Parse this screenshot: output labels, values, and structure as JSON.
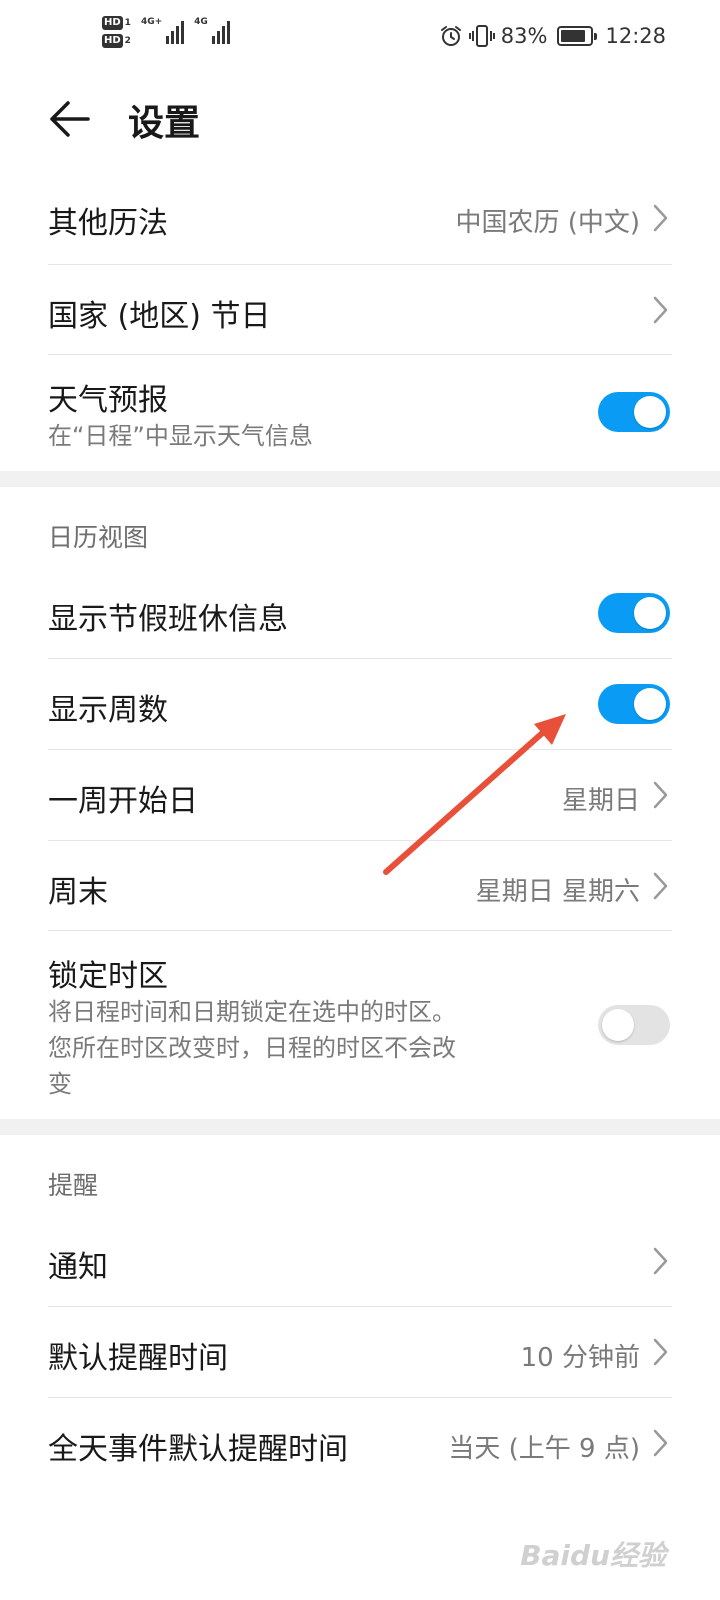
{
  "status_bar": {
    "hd1": "HD",
    "hd1_sub": "1",
    "hd2": "HD",
    "hd2_sub": "2",
    "net1": "4G+",
    "net2": "4G",
    "battery_percent": "83%",
    "battery_level": 0.83,
    "time": "12:28",
    "icons": [
      "alarm-icon",
      "vibrate-icon",
      "battery-icon"
    ]
  },
  "header": {
    "title": "设置",
    "back_icon": "arrow-left-icon"
  },
  "general": {
    "other_calendar": {
      "title": "其他历法",
      "value": "中国农历 (中文)"
    },
    "holidays": {
      "title": "国家 (地区) 节日"
    },
    "weather": {
      "title": "天气预报",
      "subtitle": "在“日程”中显示天气信息",
      "enabled": true
    }
  },
  "calendar_view": {
    "section_label": "日历视图",
    "show_holiday_info": {
      "title": "显示节假班休信息",
      "enabled": true
    },
    "show_week_numbers": {
      "title": "显示周数",
      "enabled": true
    },
    "week_start": {
      "title": "一周开始日",
      "value": "星期日"
    },
    "weekend": {
      "title": "周末",
      "value": "星期日 星期六"
    },
    "lock_timezone": {
      "title": "锁定时区",
      "subtitle_line1": "将日程时间和日期锁定在选中的时区。",
      "subtitle_line2": "您所在时区改变时，日程的时区不会改",
      "subtitle_line3": "变",
      "enabled": false
    }
  },
  "reminders": {
    "section_label": "提醒",
    "notifications": {
      "title": "通知"
    },
    "default_reminder": {
      "title": "默认提醒时间",
      "value": "10 分钟前"
    },
    "all_day_reminder": {
      "title": "全天事件默认提醒时间",
      "value": "当天 (上午 9 点)"
    }
  },
  "watermark": "Baidu经验",
  "colors": {
    "accent": "#0a9cf5",
    "annotation_arrow": "#e8503a",
    "toggle_off": "#e3e3e3",
    "divider": "#e6e6e6",
    "band": "#f1f1f1"
  }
}
